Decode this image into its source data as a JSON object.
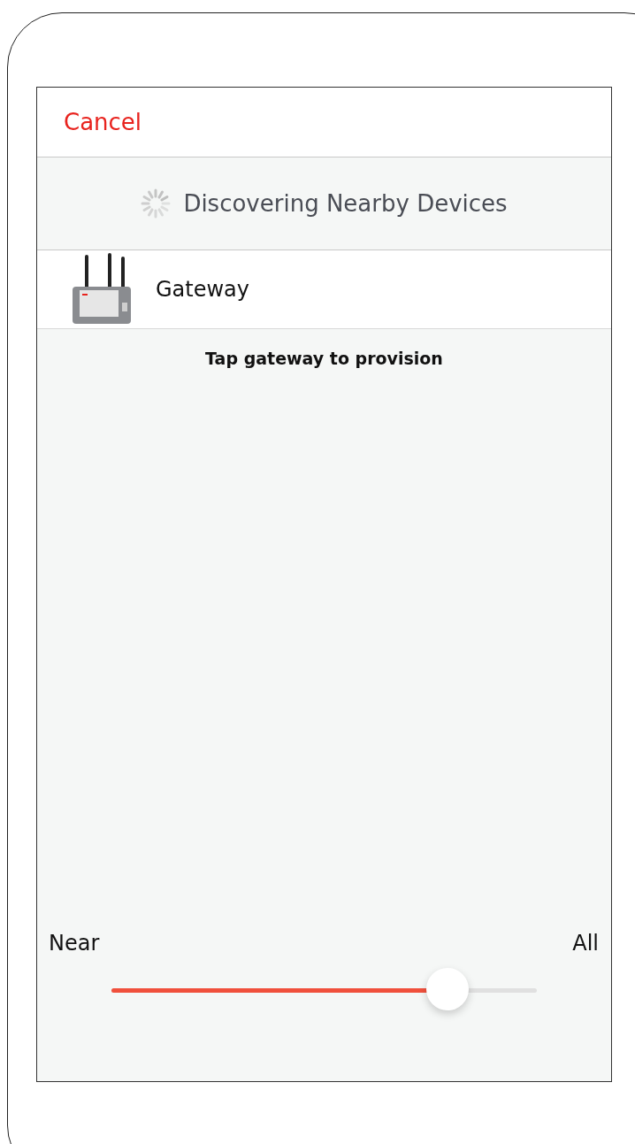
{
  "header": {
    "cancel": "Cancel"
  },
  "discovery": {
    "status": "Discovering Nearby Devices"
  },
  "devices": [
    {
      "name": "Gateway"
    }
  ],
  "hint": "Tap gateway to provision",
  "range": {
    "min_label": "Near",
    "max_label": "All",
    "level": 0.79
  }
}
